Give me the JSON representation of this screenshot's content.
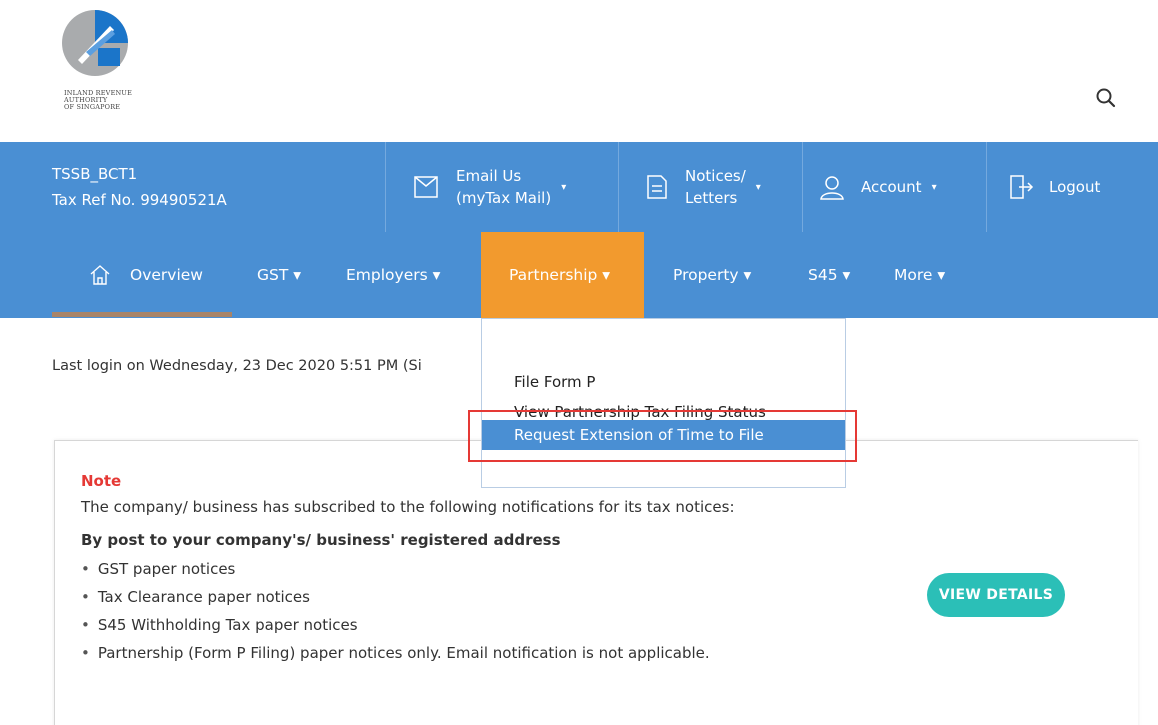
{
  "header": {
    "logo_lines": [
      "INLAND REVENUE",
      "AUTHORITY",
      "OF SINGAPORE"
    ]
  },
  "user": {
    "name": "TSSB_BCT1",
    "tax_ref": "Tax Ref No. 99490521A"
  },
  "topbar": {
    "email_line1": "Email Us",
    "email_line2": "(myTax Mail)",
    "notices_line1": "Notices/",
    "notices_line2": "Letters",
    "account": "Account",
    "logout": "Logout",
    "caret": "▾"
  },
  "nav": {
    "overview": "Overview",
    "gst": "GST ▾",
    "employers": "Employers ▾",
    "partnership": "Partnership ▾",
    "property": "Property ▾",
    "s45": "S45 ▾",
    "more": "More ▾"
  },
  "dropdown": {
    "items": [
      "File Form P",
      "View Partnership Tax Filing Status",
      "Request Extension of Time to File"
    ]
  },
  "last_login": "Last login on Wednesday, 23 Dec 2020 5:51 PM (Si",
  "note": {
    "title": "Note",
    "text": "The company/ business has subscribed to the following notifications for its tax notices:",
    "subtitle": "By post to your company's/ business' registered address",
    "items": [
      "GST paper notices",
      "Tax Clearance paper notices",
      "S45 Withholding Tax paper notices",
      "Partnership (Form P Filing) paper notices only. Email notification is not applicable."
    ],
    "button": "VIEW DETAILS"
  },
  "colors": {
    "primary_blue": "#4a8fd3",
    "active_orange": "#f29a2e",
    "note_red": "#e53935",
    "teal_button": "#2bbfb7"
  }
}
